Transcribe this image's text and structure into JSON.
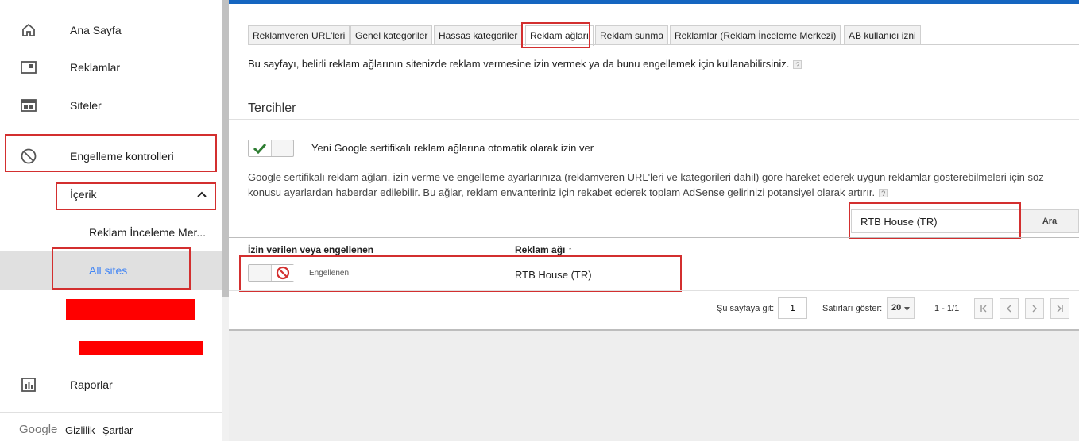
{
  "sidebar": {
    "items": [
      {
        "label": "Ana Sayfa",
        "icon": "home-icon"
      },
      {
        "label": "Reklamlar",
        "icon": "ads-icon"
      },
      {
        "label": "Siteler",
        "icon": "sites-icon"
      },
      {
        "label": "Engelleme kontrolleri",
        "icon": "block-icon"
      },
      {
        "label": "Raporlar",
        "icon": "reports-icon"
      }
    ],
    "sub_section": {
      "label": "İçerik",
      "icon": "chevron-up-icon"
    },
    "sub_items": [
      {
        "label": "Reklam İnceleme Mer..."
      },
      {
        "label": "All sites"
      }
    ],
    "footer": {
      "logo": "Google",
      "privacy": "Gizlilik",
      "terms": "Şartlar"
    }
  },
  "tabs": [
    {
      "label": "Reklamveren URL'leri"
    },
    {
      "label": "Genel kategoriler"
    },
    {
      "label": "Hassas kategoriler"
    },
    {
      "label": "Reklam ağları",
      "active": true
    },
    {
      "label": "Reklam sunma"
    },
    {
      "label": "Reklamlar (Reklam İnceleme Merkezi)"
    },
    {
      "label": "AB kullanıcı izni"
    }
  ],
  "intro_text": "Bu sayfayı, belirli reklam ağlarının sitenizde reklam vermesine izin vermek ya da bunu engellemek için kullanabilirsiniz.",
  "help_glyph": "?",
  "preferences": {
    "title": "Tercihler",
    "auto_allow_label": "Yeni Google sertifikalı reklam ağlarına otomatik olarak izin ver",
    "auto_allow_enabled": true,
    "description": "Google sertifikalı reklam ağları, izin verme ve engelleme ayarlarınıza (reklamveren URL'leri ve kategorileri dahil) göre hareket ederek uygun reklamlar gösterebilmeleri için söz konusu ayarlardan haberdar edilebilir. Bu ağlar, reklam envanteriniz için rekabet ederek toplam AdSense gelirinizi potansiyel olarak artırır."
  },
  "search": {
    "value": "RTB House (TR)",
    "button": "Ara"
  },
  "table": {
    "columns": {
      "status": "İzin verilen veya engellenen",
      "network": "Reklam ağı ↑"
    },
    "rows": [
      {
        "status": "Engellenen",
        "network": "RTB House (TR)",
        "blocked": true
      }
    ]
  },
  "pager": {
    "goto_label": "Şu sayfaya git:",
    "page": "1",
    "rows_label": "Satırları göster:",
    "rows_value": "20",
    "range": "1 - 1/1"
  },
  "colors": {
    "accent": "#1565c0",
    "link": "#4285f4",
    "check": "#2e7d32",
    "blocked": "#d32f2f",
    "highlight": "#d32f2f"
  }
}
